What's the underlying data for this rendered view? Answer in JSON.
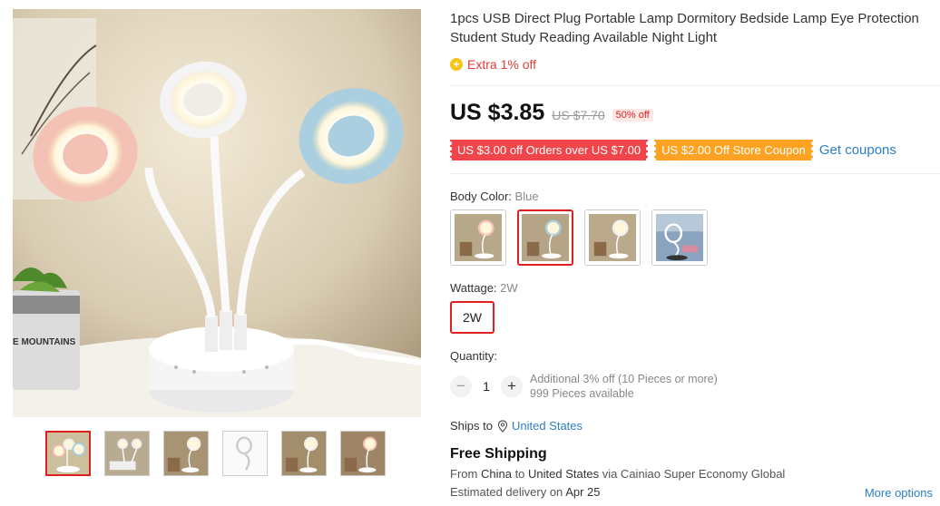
{
  "product": {
    "title": "1pcs USB Direct Plug Portable Lamp Dormitory Bedside Lamp Eye Protection Student Study Reading Available Night Light",
    "extra_discount": "Extra 1% off",
    "price": "US $3.85",
    "original_price": "US $7.70",
    "discount_badge": "50% off"
  },
  "gallery": {
    "image_text": "E MOUNTAINS",
    "thumbnails": [
      "thumbnail-1",
      "thumbnail-2",
      "thumbnail-3",
      "thumbnail-4",
      "thumbnail-5",
      "thumbnail-6"
    ]
  },
  "coupons": {
    "coupon_1": "US $3.00 off Orders over US $7.00",
    "coupon_2": "US $2.00 Off Store Coupon",
    "get_coupons": "Get coupons"
  },
  "body_color": {
    "label": "Body Color:",
    "selected": "Blue"
  },
  "wattage": {
    "label": "Wattage:",
    "selected": "2W",
    "option": "2W"
  },
  "quantity": {
    "label": "Quantity:",
    "minus": "−",
    "plus": "+",
    "value": "1",
    "additional": "Additional 3% off (10 Pieces or more)",
    "available": "999 Pieces available"
  },
  "shipping": {
    "ships_to_label": "Ships to",
    "country": "United States",
    "free_shipping": "Free Shipping",
    "from_prefix": "From",
    "from_country": "China",
    "to_word": "to",
    "to_country": "United States",
    "via_text": "via Cainiao Super Economy Global",
    "est_prefix": "Estimated delivery on",
    "est_date": "Apr 25",
    "more_options": "More options"
  },
  "colors": {
    "accent_red": "#e02020",
    "price_red": "#e63b35",
    "coupon_red": "#f0454a",
    "coupon_orange": "#fea224",
    "link_blue": "#2c7fc4"
  }
}
